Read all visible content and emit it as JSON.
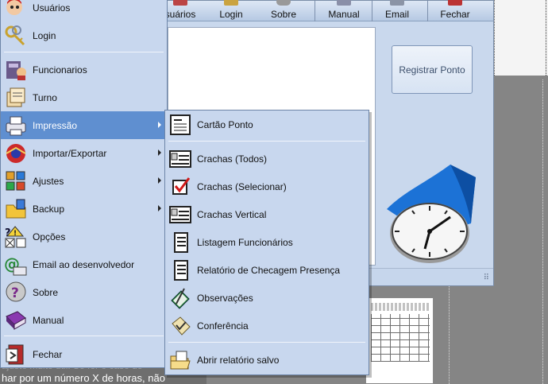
{
  "toolbar": {
    "buttons": [
      {
        "label": "suários"
      },
      {
        "label": "Login"
      },
      {
        "label": "Sobre"
      },
      {
        "label": "Manual"
      },
      {
        "label": "Email"
      },
      {
        "label": "Fechar"
      }
    ]
  },
  "register_button": "Registrar Ponto",
  "main_menu": {
    "items": [
      {
        "label": "Usuários",
        "icon": "users-icon"
      },
      {
        "label": "Login",
        "icon": "keys-icon"
      },
      {
        "label": "Funcionarios",
        "icon": "employees-icon"
      },
      {
        "label": "Turno",
        "icon": "shift-icon"
      },
      {
        "label": "Impressão",
        "icon": "printer-icon",
        "submenu": true,
        "highlighted": true
      },
      {
        "label": "Importar/Exportar",
        "icon": "import-export-icon",
        "submenu": true
      },
      {
        "label": "Ajustes",
        "icon": "settings-icon",
        "submenu": true
      },
      {
        "label": "Backup",
        "icon": "backup-icon",
        "submenu": true
      },
      {
        "label": "Opções",
        "icon": "options-icon"
      },
      {
        "label": "Email ao desenvolvedor",
        "icon": "email-icon"
      },
      {
        "label": "Sobre",
        "icon": "help-icon"
      },
      {
        "label": "Manual",
        "icon": "manual-icon"
      },
      {
        "label": "Fechar",
        "icon": "exit-icon"
      }
    ]
  },
  "print_submenu": {
    "items": [
      {
        "label": "Cartão Ponto",
        "icon": "timecard-icon"
      },
      {
        "label": "Crachas (Todos)",
        "icon": "badge-icon"
      },
      {
        "label": "Crachas (Selecionar)",
        "icon": "checkmark-icon"
      },
      {
        "label": "Crachas Vertical",
        "icon": "badge-vertical-icon"
      },
      {
        "label": "Listagem Funcionários",
        "icon": "list-icon"
      },
      {
        "label": "Relatório de Checagem Presença",
        "icon": "report-icon"
      },
      {
        "label": "Observações",
        "icon": "notes-icon"
      },
      {
        "label": "Conferência",
        "icon": "check-document-icon"
      },
      {
        "label": "Abrir relatório salvo",
        "icon": "open-folder-icon"
      }
    ]
  },
  "background_text": {
    "line1": "har por um número X de horas, não",
    "line0": "ajuste muito útil. Se for o caso de"
  }
}
